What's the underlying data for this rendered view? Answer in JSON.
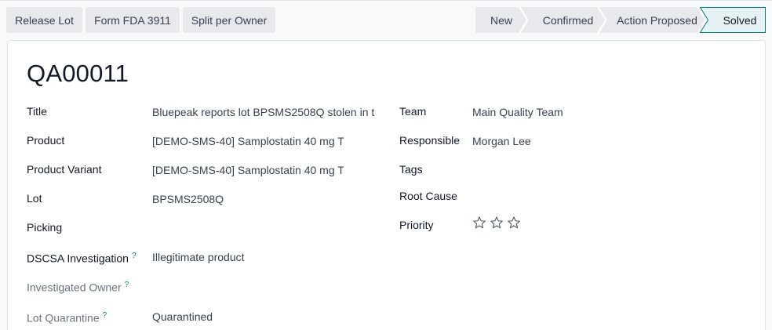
{
  "actions": {
    "release_lot": "Release Lot",
    "form_fda": "Form FDA 3911",
    "split_owner": "Split per Owner"
  },
  "status": {
    "stages": [
      "New",
      "Confirmed",
      "Action Proposed",
      "Solved"
    ],
    "active": "Solved"
  },
  "record": {
    "name": "QA00011"
  },
  "fields_left": {
    "title_label": "Title",
    "title_value": "Bluepeak reports lot BPSMS2508Q stolen in t",
    "product_label": "Product",
    "product_value": "[DEMO-SMS-40] Samplostatin 40 mg T",
    "variant_label": "Product Variant",
    "variant_value": "[DEMO-SMS-40] Samplostatin 40 mg T",
    "lot_label": "Lot",
    "lot_value": "BPSMS2508Q",
    "picking_label": "Picking",
    "picking_value": "",
    "dscsa_label": "DSCSA Investigation",
    "dscsa_value": "Illegitimate product",
    "owner_label": "Investigated Owner",
    "owner_value": "",
    "quarantine_label": "Lot Quarantine",
    "quarantine_value": "Quarantined",
    "help_mark": "?"
  },
  "fields_right": {
    "team_label": "Team",
    "team_value": "Main Quality Team",
    "responsible_label": "Responsible",
    "responsible_value": "Morgan Lee",
    "tags_label": "Tags",
    "tags_value": "",
    "root_cause_label": "Root Cause",
    "root_cause_value": "",
    "priority_label": "Priority",
    "priority_stars_filled": 0,
    "priority_stars_total": 3,
    "priority_icon": "star-outline-icon"
  },
  "colors": {
    "active_stage_bg": "#e6f2f3",
    "active_stage_border": "#017e84",
    "help_mark": "#017e84"
  }
}
